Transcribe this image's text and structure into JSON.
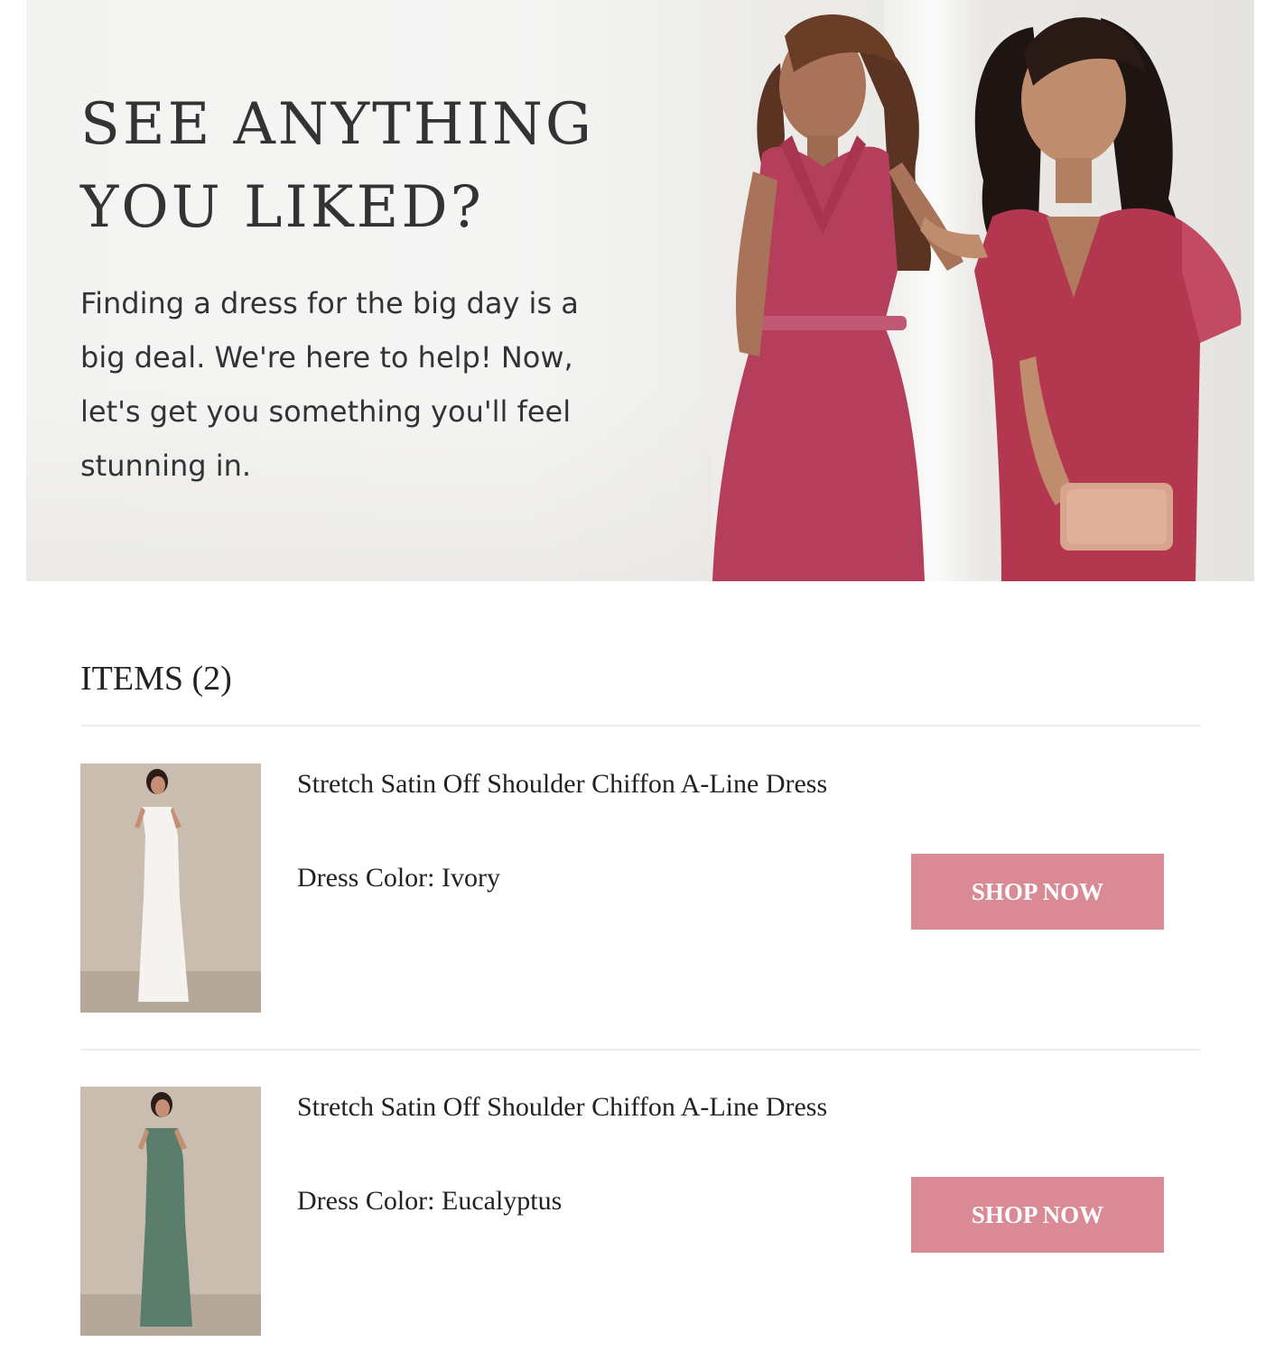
{
  "hero": {
    "title_line1": "SEE ANYTHING",
    "title_line2": "YOU LIKED?",
    "body_line1": "Finding a dress for the big day is a",
    "body_line2": "big deal. We're here to help! Now,",
    "body_line3": "let's get you something you'll feel",
    "body_line4": "stunning in.",
    "image": "two-models-in-rose-dresses"
  },
  "items": {
    "heading": "ITEMS (2)",
    "list": [
      {
        "name": "Stretch Satin Off Shoulder Chiffon A-Line Dress",
        "color_line": "Dress Color: Ivory",
        "button": "SHOP NOW",
        "dress_hex": "#f4f3ef",
        "image": "model-in-ivory-dress"
      },
      {
        "name": "Stretch Satin Off Shoulder Chiffon A-Line Dress",
        "color_line": "Dress Color: Eucalyptus",
        "button": "SHOP NOW",
        "dress_hex": "#5a7d6c",
        "image": "model-in-eucalyptus-dress"
      }
    ]
  },
  "colors": {
    "button_bg": "#d98a94",
    "dress_rose": "#b23e5c",
    "text": "#333333"
  }
}
